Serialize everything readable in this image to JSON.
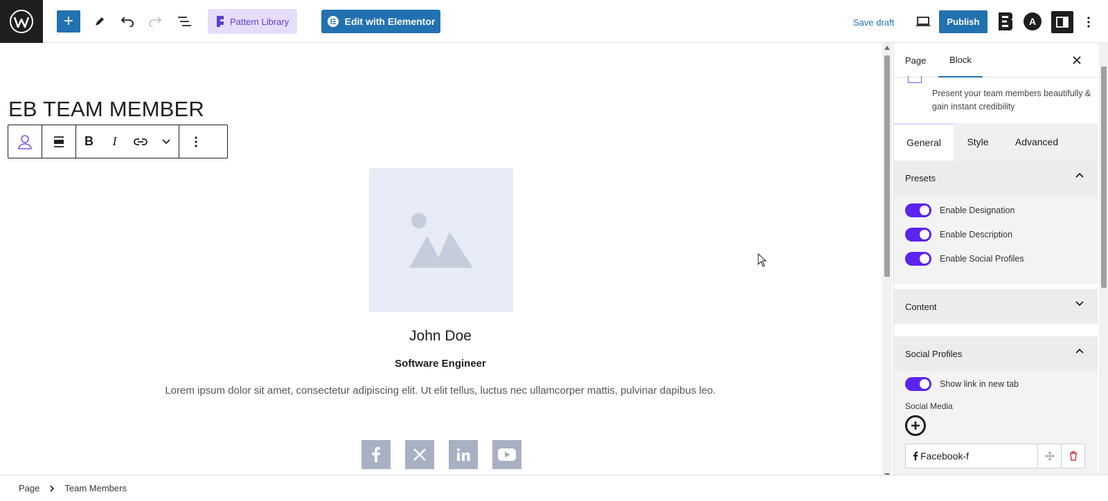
{
  "topbar": {
    "pattern_library_label": "Pattern Library",
    "edit_elementor_label": "Edit with Elementor",
    "save_draft_label": "Save draft",
    "publish_label": "Publish",
    "astra_logo_letter": "A"
  },
  "canvas": {
    "heading": "EB TEAM MEMBER",
    "toolbar": {
      "bold_label": "B",
      "italic_label": "I"
    },
    "member": {
      "name": "John Doe",
      "designation": "Software Engineer",
      "description": "Lorem ipsum dolor sit amet, consectetur adipiscing elit. Ut elit tellus, luctus nec ullamcorper mattis, pulvinar dapibus leo."
    },
    "socials": [
      "facebook-icon",
      "x-icon",
      "linkedin-icon",
      "youtube-icon"
    ]
  },
  "sidebar": {
    "tab_page": "Page",
    "tab_block": "Block",
    "block_description": "Present your team members beautifully & gain instant credibility",
    "subtabs": {
      "general": "General",
      "style": "Style",
      "advanced": "Advanced"
    },
    "presets": {
      "title": "Presets",
      "toggles": [
        {
          "label": "Enable Designation",
          "on": true
        },
        {
          "label": "Enable Description",
          "on": true
        },
        {
          "label": "Enable Social Profiles",
          "on": true
        }
      ]
    },
    "content_title": "Content",
    "social_profiles": {
      "title": "Social Profiles",
      "new_tab_label": "Show link in new tab",
      "new_tab_on": true,
      "social_media_label": "Social Media",
      "items": [
        {
          "label": "Facebook-f",
          "icon": "facebook-icon"
        }
      ]
    }
  },
  "footer": {
    "breadcrumb": [
      "Page",
      "Team Members"
    ]
  },
  "colors": {
    "primary": "#2271b1",
    "toggle_on": "#5b23f0",
    "pattern_bg": "#e6ddfb",
    "social_bg": "#a8b0c3"
  }
}
